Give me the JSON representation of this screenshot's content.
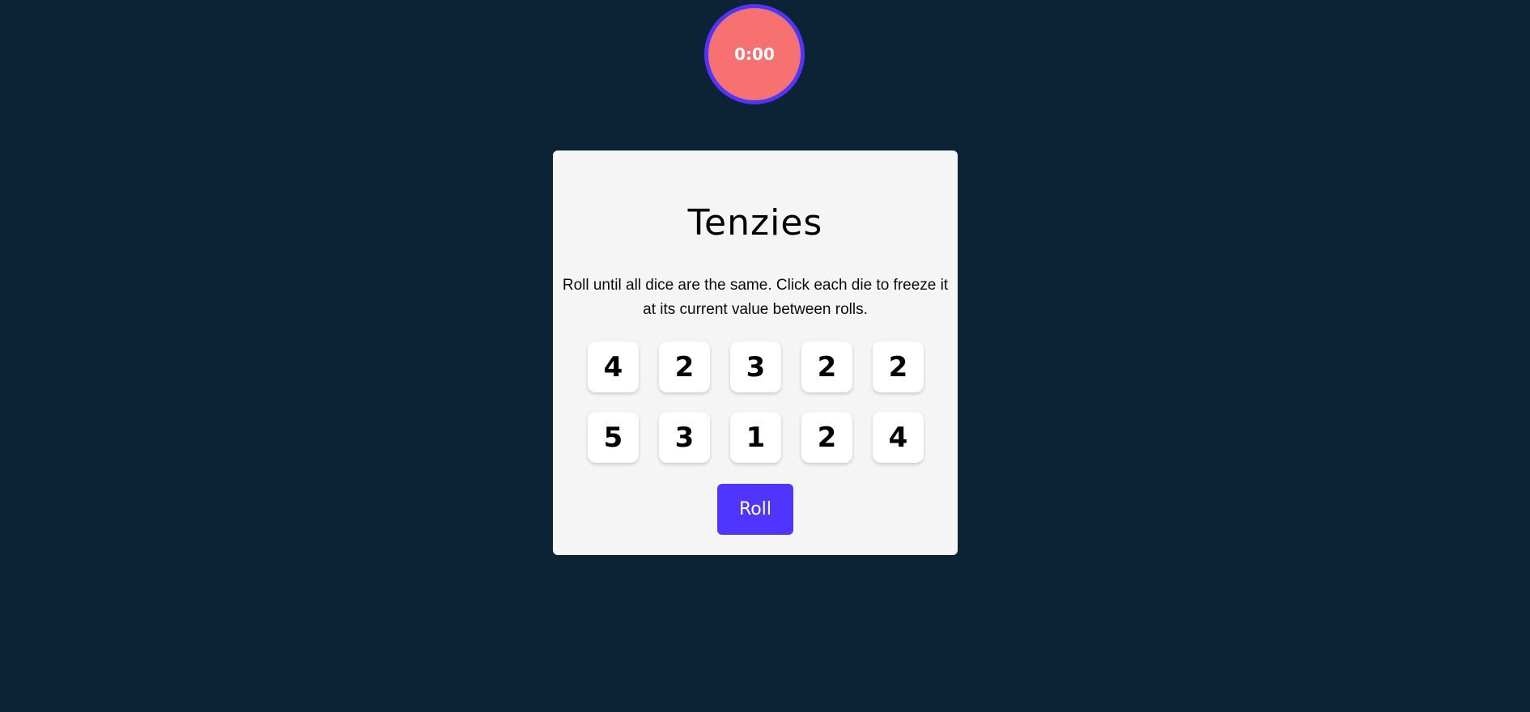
{
  "timer": {
    "display": "0:00",
    "fill_color": "#f87171",
    "ring_color": "#5035ff"
  },
  "game": {
    "title": "Tenzies",
    "instructions": "Roll until all dice are the same. Click each die to freeze it at its current value between rolls.",
    "dice": [
      {
        "value": "4",
        "held": false
      },
      {
        "value": "2",
        "held": false
      },
      {
        "value": "3",
        "held": false
      },
      {
        "value": "2",
        "held": false
      },
      {
        "value": "2",
        "held": false
      },
      {
        "value": "5",
        "held": false
      },
      {
        "value": "3",
        "held": false
      },
      {
        "value": "1",
        "held": false
      },
      {
        "value": "2",
        "held": false
      },
      {
        "value": "4",
        "held": false
      }
    ],
    "roll_label": "Roll",
    "accent_color": "#5035ff",
    "background_color": "#0b2334",
    "card_color": "#f5f5f5"
  }
}
